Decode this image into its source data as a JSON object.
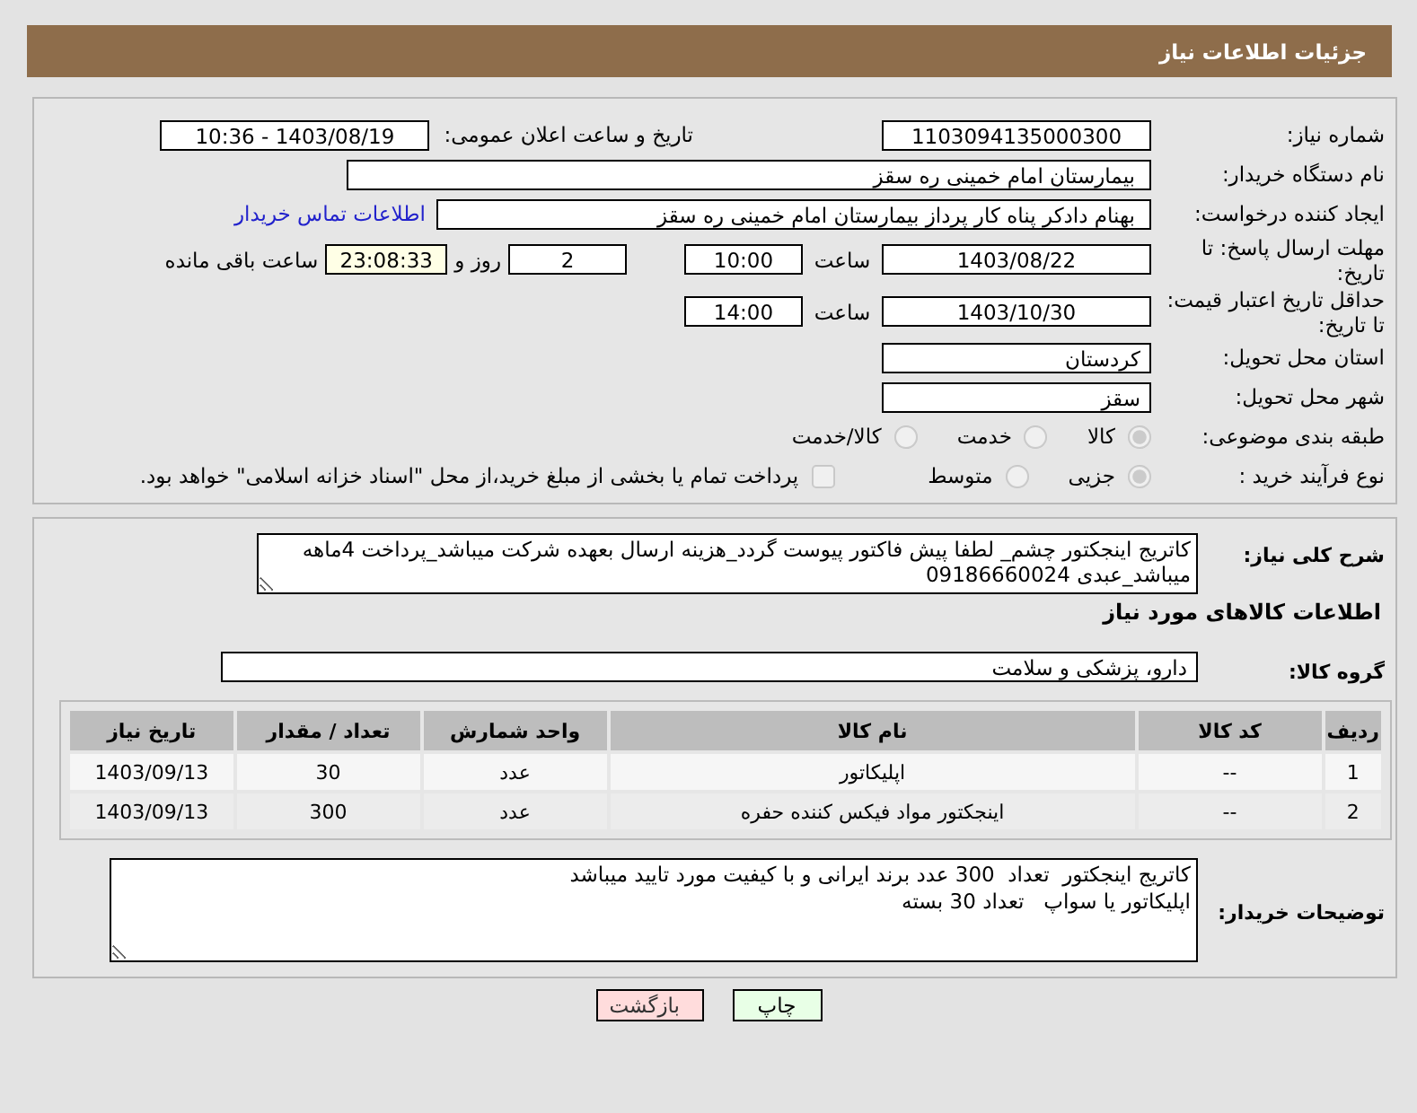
{
  "header": {
    "title": "جزئیات اطلاعات نیاز"
  },
  "need_number": {
    "label": "شماره نیاز:",
    "value": "1103094135000300"
  },
  "announce": {
    "label": "تاریخ و ساعت اعلان عمومی:",
    "value": "1403/08/19 - 10:36"
  },
  "buyer_org": {
    "label": "نام دستگاه خریدار:",
    "value": "بیمارستان امام خمینی  ره  سقز"
  },
  "requester": {
    "label": "ایجاد کننده درخواست:",
    "value": "بهنام دادکر پناه کار پرداز بیمارستان امام خمینی  ره  سقز",
    "link": "اطلاعات تماس خریدار"
  },
  "reply_deadline": {
    "label": "مهلت ارسال پاسخ: تا تاریخ:",
    "date": "1403/08/22",
    "time_label": "ساعت",
    "time": "10:00",
    "days": "2",
    "days_label": "روز و",
    "remaining": "23:08:33",
    "remaining_label": "ساعت باقی مانده"
  },
  "price_validity": {
    "label": "حداقل تاریخ اعتبار قیمت: تا تاریخ:",
    "date": "1403/10/30",
    "time_label": "ساعت",
    "time": "14:00"
  },
  "province": {
    "label": "استان محل تحویل:",
    "value": "کردستان"
  },
  "city": {
    "label": "شهر محل تحویل:",
    "value": "سقز"
  },
  "category": {
    "label": "طبقه بندی موضوعی:",
    "options": [
      {
        "label": "کالا",
        "selected": true
      },
      {
        "label": "خدمت",
        "selected": false
      },
      {
        "label": "کالا/خدمت",
        "selected": false
      }
    ]
  },
  "purchase_type": {
    "label": "نوع فرآیند خرید :",
    "options": [
      {
        "label": "جزیی",
        "selected": true
      },
      {
        "label": "متوسط",
        "selected": false
      }
    ],
    "checkbox": {
      "label": "پرداخت تمام یا بخشی از مبلغ خرید،از محل \"اسناد خزانه اسلامی\" خواهد بود.",
      "checked": false
    }
  },
  "description": {
    "label": "شرح کلی نیاز:",
    "value": "کاتریج اینجکتور چشم_ لطفا پیش فاکتور پیوست گردد_هزینه ارسال بعهده شرکت میباشد_پرداخت 4ماهه میباشد_عبدی 09186660024"
  },
  "items_heading": "اطلاعات کالاهای مورد نیاز",
  "goods_group": {
    "label": "گروه کالا:",
    "value": "دارو، پزشکی و سلامت"
  },
  "table": {
    "columns": [
      "ردیف",
      "کد کالا",
      "نام کالا",
      "واحد شمارش",
      "تعداد / مقدار",
      "تاریخ نیاز"
    ],
    "rows": [
      [
        "1",
        "--",
        "اپلیکاتور",
        "عدد",
        "30",
        "1403/09/13"
      ],
      [
        "2",
        "--",
        "اینجکتور مواد فیکس کننده حفره",
        "عدد",
        "300",
        "1403/09/13"
      ]
    ]
  },
  "buyer_notes": {
    "label": "توضیحات خریدار:",
    "value": "کاتریج اینجکتور  تعداد  300 عدد برند ایرانی و با کیفیت مورد تایید میباشد\nاپلیکاتور یا سواپ   تعداد 30 بسته"
  },
  "buttons": [
    {
      "label": "چاپ",
      "kind": "print"
    },
    {
      "label": "بازگشت",
      "kind": "back"
    }
  ]
}
